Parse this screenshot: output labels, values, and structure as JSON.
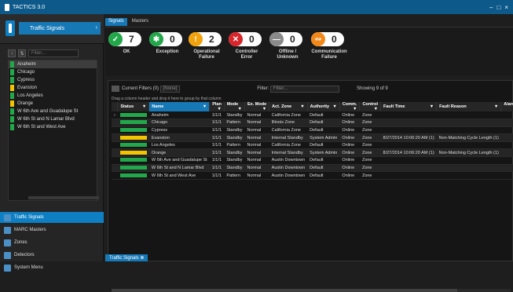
{
  "window": {
    "title": "TACTICS 3.0",
    "controls": [
      "–",
      "□",
      "×"
    ]
  },
  "left_panel": {
    "header_label": "Traffic Signals",
    "filter_placeholder": "Filter...",
    "tool_buttons": [
      "↓",
      "⇅"
    ],
    "items": [
      {
        "label": "Anaheim",
        "color": "#22a84a",
        "selected": true
      },
      {
        "label": "Chicago",
        "color": "#22a84a"
      },
      {
        "label": "Cypress",
        "color": "#22a84a"
      },
      {
        "label": "Evanston",
        "color": "#f2c500"
      },
      {
        "label": "Los Angeles",
        "color": "#22a84a"
      },
      {
        "label": "Orange",
        "color": "#f2c500"
      },
      {
        "label": "W 6th Ave and Guadalupe St",
        "color": "#22a84a"
      },
      {
        "label": "W 6th St and N Lamar Blvd",
        "color": "#22a84a"
      },
      {
        "label": "W 6th St and West Ave",
        "color": "#22a84a"
      }
    ]
  },
  "nav": [
    {
      "label": "Traffic Signals",
      "icon": "traffic-light-icon",
      "active": true
    },
    {
      "label": "MARC Masters",
      "icon": "controller-icon"
    },
    {
      "label": "Zones",
      "icon": "zones-icon"
    },
    {
      "label": "Detectors",
      "icon": "detector-icon"
    },
    {
      "label": "System Menu",
      "icon": "gear-icon"
    }
  ],
  "tabs": [
    "Signals",
    "Masters"
  ],
  "summary": [
    {
      "count": "7",
      "label": "OK",
      "color": "#22a84a",
      "glyph": "✓"
    },
    {
      "count": "0",
      "label": "Exception",
      "color": "#22a84a",
      "glyph": "✱"
    },
    {
      "count": "2",
      "label": "Operational\nFailure",
      "color": "#f2a20c",
      "glyph": "!"
    },
    {
      "count": "0",
      "label": "Controller\nError",
      "color": "#d9262b",
      "glyph": "✕"
    },
    {
      "count": "0",
      "label": "Offline /\nUnknown",
      "color": "#8a8a8a",
      "glyph": "—"
    },
    {
      "count": "0",
      "label": "Communication\nFailure",
      "color": "#f2881a",
      "glyph": "∾"
    }
  ],
  "filters": {
    "current_label": "Current Filters (0)",
    "current_value": "[None]",
    "filter_label": "Filter:",
    "filter_placeholder": "Filter...",
    "showing": "Showing 9 of 9"
  },
  "group_hint": "Drag a column header and drop it here to group by that column",
  "columns": [
    "Status",
    "Name",
    "Plan",
    "Mode",
    "Ex. Mode",
    "Act. Zone",
    "Authority",
    "Comm.",
    "Control",
    "Fault Time",
    "Fault Reason",
    "Alarms"
  ],
  "rows": [
    {
      "status": "#22a84a",
      "cells": [
        "Anaheim",
        "1/1/1",
        "Standby",
        "Normal",
        "California Zone",
        "Default",
        "Online",
        "Zone",
        "",
        "",
        ""
      ]
    },
    {
      "status": "#22a84a",
      "cells": [
        "Chicago",
        "1/1/1",
        "Pattern",
        "Normal",
        "Illinois Zone",
        "Default",
        "Online",
        "Zone",
        "",
        "",
        ""
      ]
    },
    {
      "status": "#22a84a",
      "cells": [
        "Cypress",
        "1/1/1",
        "Standby",
        "Normal",
        "California Zone",
        "Default",
        "Online",
        "Zone",
        "",
        "",
        ""
      ]
    },
    {
      "status": "#f2c500",
      "cells": [
        "Evanston",
        "1/1/1",
        "Standby",
        "Normal",
        "Internal Standby",
        "System Admin",
        "Online",
        "Zone",
        "8/27/2014 10:06:20 AM (1)",
        "Non-Matching Cycle Length (1)",
        ""
      ]
    },
    {
      "status": "#22a84a",
      "cells": [
        "Los Angeles",
        "1/1/1",
        "Pattern",
        "Normal",
        "California Zone",
        "Default",
        "Online",
        "Zone",
        "",
        "",
        ""
      ]
    },
    {
      "status": "#f2c500",
      "cells": [
        "Orange",
        "1/1/1",
        "Standby",
        "Normal",
        "Internal Standby",
        "System Admin",
        "Online",
        "Zone",
        "8/27/2014 10:06:20 AM (1)",
        "Non-Matching Cycle Length (1)",
        ""
      ]
    },
    {
      "status": "#22a84a",
      "cells": [
        "W 6th Ave and Guadalupe St",
        "1/1/1",
        "Standby",
        "Normal",
        "Austin Downtown",
        "Default",
        "Online",
        "Zone",
        "",
        "",
        ""
      ]
    },
    {
      "status": "#22a84a",
      "cells": [
        "W 6th St and N Lamar Blvd",
        "1/1/1",
        "Standby",
        "Normal",
        "Austin Downtown",
        "Default",
        "Online",
        "Zone",
        "",
        "",
        ""
      ]
    },
    {
      "status": "#22a84a",
      "cells": [
        "W 6th St and West Ave",
        "1/1/1",
        "Pattern",
        "Normal",
        "Austin Downtown",
        "Default",
        "Online",
        "Zone",
        "",
        "",
        ""
      ]
    }
  ],
  "bottom_tab": "Traffic Signals"
}
